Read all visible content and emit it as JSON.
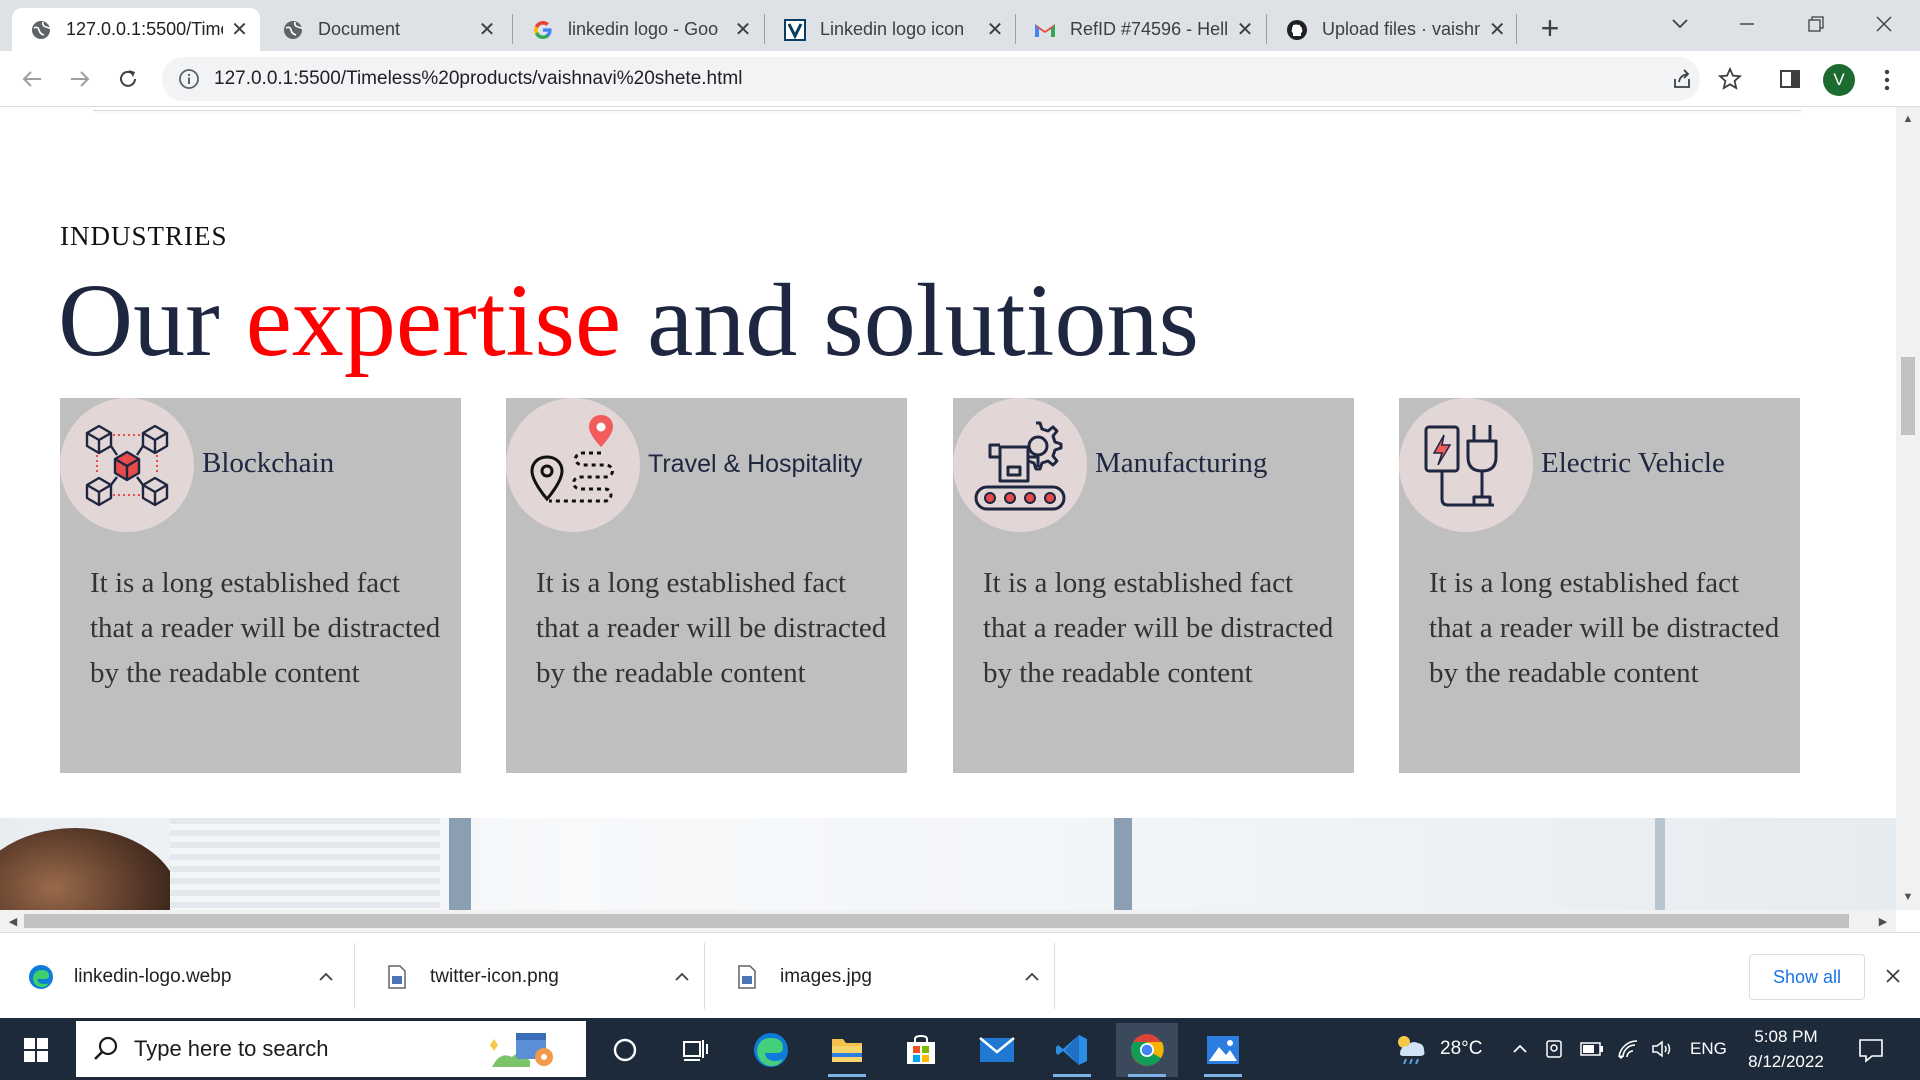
{
  "browser": {
    "tabs": [
      {
        "title": "127.0.0.1:5500/Time",
        "icon": "globe-icon",
        "active": true
      },
      {
        "title": "Document",
        "icon": "globe-icon",
        "active": false
      },
      {
        "title": "linkedin logo - Goo",
        "icon": "google-icon",
        "active": false
      },
      {
        "title": "Linkedin logo icon",
        "icon": "vectorstock-icon",
        "active": false
      },
      {
        "title": "RefID #74596 - Hell",
        "icon": "gmail-icon",
        "active": false
      },
      {
        "title": "Upload files · vaishn",
        "icon": "github-icon",
        "active": false
      }
    ],
    "url": "127.0.0.1:5500/Timeless%20products/vaishnavi%20shete.html",
    "profile_initial": "V"
  },
  "page": {
    "eyebrow": "INDUSTRIES",
    "headline": {
      "part1": "Our ",
      "accent": "expertise",
      "part2": " and solutions"
    },
    "accent_color": "#ff0000",
    "heading_color": "#1f2640",
    "card_background": "#bfbfbf",
    "cards": [
      {
        "title": "Blockchain",
        "icon": "blockchain-cubes-icon",
        "text": "It is a long established fact that a reader will be distracted by the readable content"
      },
      {
        "title": "Travel & Hospitality",
        "icon": "travel-route-pin-icon",
        "text": "It is a long established fact that a reader will be distracted by the readable content"
      },
      {
        "title": "Manufacturing",
        "icon": "manufacturing-conveyor-gear-icon",
        "text": "It is a long established fact that a reader will be distracted by the readable content"
      },
      {
        "title": "Electric Vehicle",
        "icon": "ev-charging-plug-icon",
        "text": "It is a long established fact that a reader will be distracted by the readable content"
      }
    ]
  },
  "downloads": {
    "items": [
      {
        "name": "linkedin-logo.webp",
        "icon": "edge-file-icon"
      },
      {
        "name": "twitter-icon.png",
        "icon": "image-file-icon"
      },
      {
        "name": "images.jpg",
        "icon": "image-file-icon"
      }
    ],
    "show_all_label": "Show all"
  },
  "taskbar": {
    "search_placeholder": "Type here to search",
    "pinned": [
      "cortana-icon",
      "task-view-icon",
      "edge-icon",
      "file-explorer-icon",
      "microsoft-store-icon",
      "mail-icon",
      "vscode-icon",
      "chrome-icon",
      "photos-icon"
    ],
    "weather": "28°C",
    "language": "ENG",
    "time": "5:08 PM",
    "date": "8/12/2022"
  }
}
